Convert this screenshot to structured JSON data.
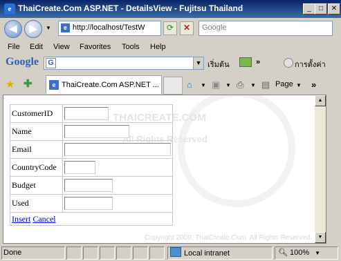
{
  "window": {
    "title": "ThaiCreate.Com ASP.NET - DetailsView - Fujitsu Thailand",
    "minimize": "_",
    "maximize": "□",
    "close": "✕"
  },
  "address_bar": {
    "url": "http://localhost/TestW",
    "search_placeholder": "Google"
  },
  "menu": [
    "File",
    "Edit",
    "View",
    "Favorites",
    "Tools",
    "Help"
  ],
  "google_toolbar": {
    "logo": "Google",
    "search_button": "เริ่มต้น",
    "settings": "การตั้งค่า"
  },
  "tabs": [
    {
      "label": "ThaiCreate.Com ASP.NET ..."
    }
  ],
  "command_bar": {
    "page": "Page"
  },
  "watermark": {
    "line1": "THAICREATE.COM",
    "line2": "All Rights Reserved",
    "copyright": "Copyright 2009, ThaiCreate.Com. All Rights Reserved."
  },
  "details_view": {
    "fields": [
      {
        "label": "CustomerID",
        "value": ""
      },
      {
        "label": "Name",
        "value": ""
      },
      {
        "label": "Email",
        "value": ""
      },
      {
        "label": "CountryCode",
        "value": ""
      },
      {
        "label": "Budget",
        "value": ""
      },
      {
        "label": "Used",
        "value": ""
      }
    ],
    "insert_link": "Insert",
    "cancel_link": "Cancel"
  },
  "status_bar": {
    "status": "Done",
    "zone": "Local intranet",
    "zoom": "100%"
  }
}
